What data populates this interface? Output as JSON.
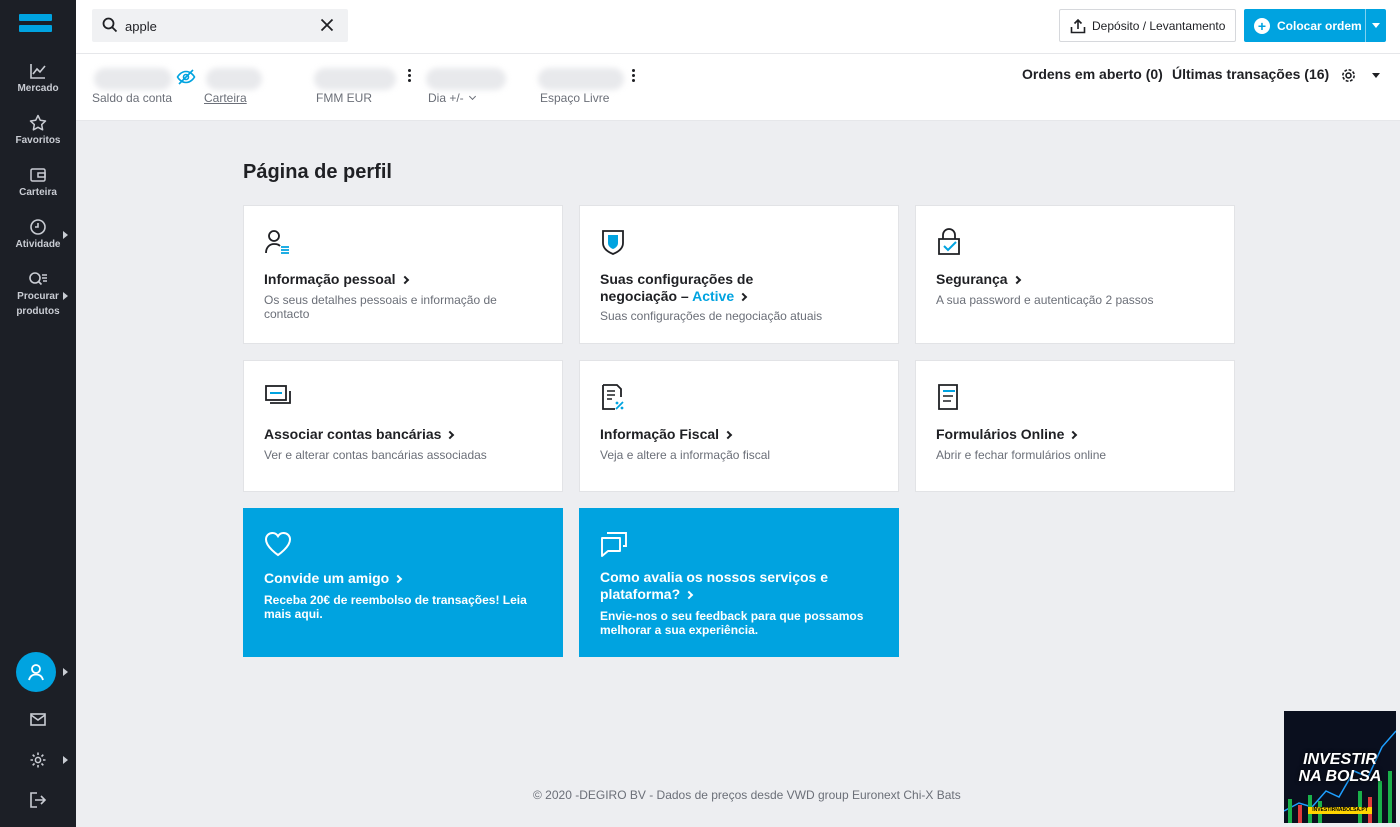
{
  "sidebar": {
    "items": [
      {
        "label": "Mercado",
        "icon": "chart-line-icon"
      },
      {
        "label": "Favoritos",
        "icon": "star-icon"
      },
      {
        "label": "Carteira",
        "icon": "wallet-icon"
      },
      {
        "label": "Atividade",
        "icon": "clock-icon"
      },
      {
        "label": "Procurar",
        "label2": "produtos",
        "icon": "search-list-icon"
      }
    ]
  },
  "search": {
    "value": "apple"
  },
  "header": {
    "deposit_label": "Depósito / Levantamento",
    "order_label": "Colocar ordem"
  },
  "account": {
    "balance_label": "Saldo da conta",
    "portfolio_label": "Carteira",
    "fmm_label": "FMM EUR",
    "day_label": "Dia +/-",
    "free_space_label": "Espaço Livre",
    "open_orders": "Ordens em aberto (0)",
    "last_transactions": "Últimas transações (16)"
  },
  "main": {
    "title": "Página de perfil",
    "cards": [
      {
        "title": "Informação pessoal",
        "desc": "Os seus detalhes pessoais e informação de contacto",
        "icon": "person-list-icon"
      },
      {
        "title": "Suas configurações de",
        "title2": "negociação –",
        "active": "Active",
        "desc": "Suas configurações de negociação atuais",
        "icon": "shield-icon"
      },
      {
        "title": "Segurança",
        "desc": "A sua password e autenticação 2 passos",
        "icon": "lock-check-icon"
      },
      {
        "title": "Associar contas bancárias",
        "desc": "Ver e alterar contas bancárias associadas",
        "icon": "bank-cards-icon"
      },
      {
        "title": "Informação Fiscal",
        "desc": "Veja e altere a informação fiscal",
        "icon": "tax-document-icon"
      },
      {
        "title": "Formulários Online",
        "desc": "Abrir e fechar formulários online",
        "icon": "form-document-icon"
      },
      {
        "title": "Convide um amigo",
        "desc": "Receba 20€ de reembolso de transações! Leia mais aqui.",
        "icon": "heart-icon"
      },
      {
        "title": "Como avalia os nossos serviços e",
        "title2": "plataforma?",
        "desc": "Envie-nos o seu feedback para que possamos melhorar a sua experiência.",
        "icon": "chat-icon"
      }
    ]
  },
  "footer": {
    "text": "© 2020 -DEGIRO BV - Dados de preços desde VWD group Euronext Chi-X Bats"
  },
  "promo": {
    "line1": "INVESTIR",
    "line2": "NA BOLSA",
    "url": "INVESTIRNABOLSA.PT"
  },
  "colors": {
    "accent": "#00a3e0",
    "sidebar": "#1c1f26",
    "background": "#edeef1"
  }
}
